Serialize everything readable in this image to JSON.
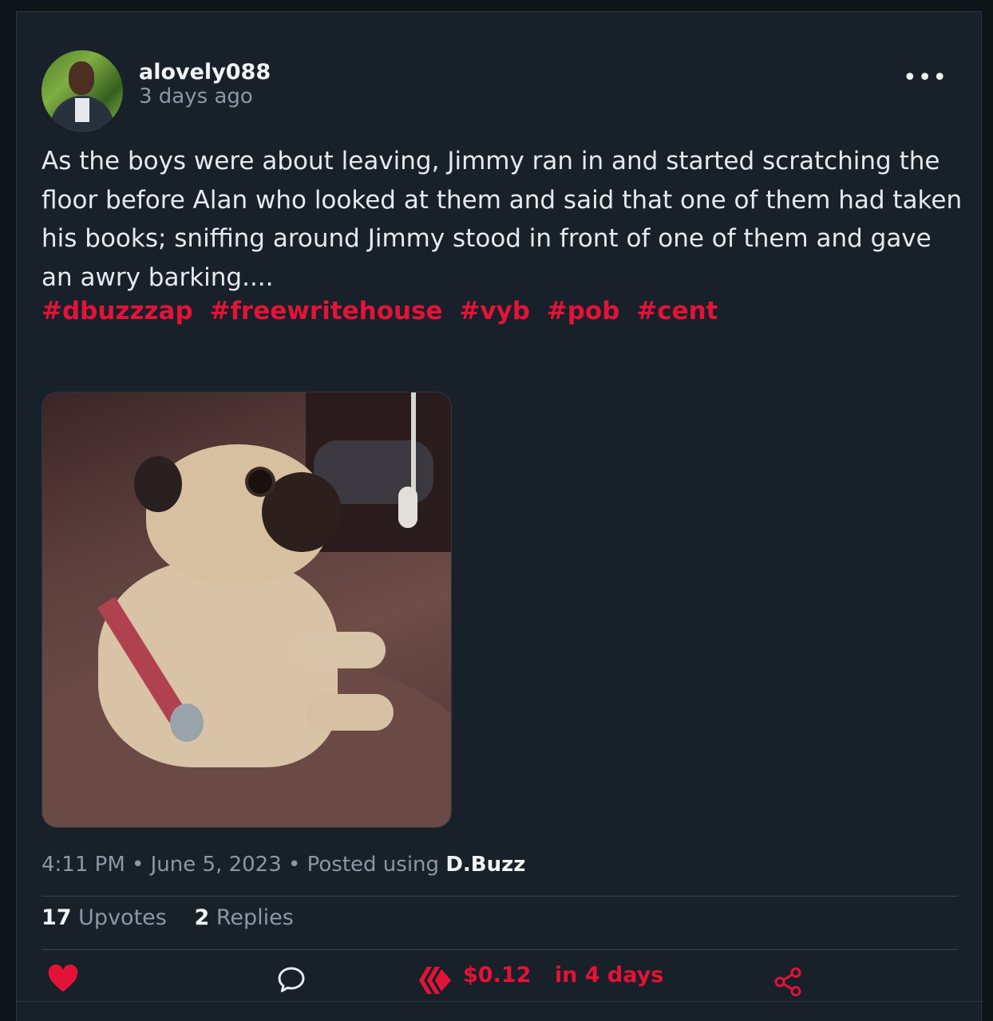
{
  "post": {
    "username": "alovely088",
    "time_ago": "3 days ago",
    "menu_icon": "more-dots-icon",
    "body": "As the boys were about leaving, Jimmy ran in and started scratching the floor before Alan who looked at them and said that one of them had taken his books; sniffing around Jimmy stood in front of one of them and gave an awry barking....",
    "hashtags": [
      "#dbuzzzap",
      "#freewritehouse",
      "#vyb",
      "#pob",
      "#cent"
    ],
    "meta": {
      "time": "4:11 PM",
      "date": "June 5, 2023",
      "posted_using": "Posted using",
      "app": "D.Buzz",
      "separator": "•"
    },
    "stats": {
      "upvotes_count": "17",
      "upvotes_label": "Upvotes",
      "replies_count": "2",
      "replies_label": "Replies"
    },
    "actions": {
      "like_icon": "heart-icon",
      "reply_icon": "comment-icon",
      "hive_icon": "hive-logo-icon",
      "payout": "$0.12",
      "payout_time": "in 4 days",
      "share_icon": "share-icon"
    }
  },
  "colors": {
    "background": "#0f1419",
    "card": "#18202a",
    "accent": "#e31337",
    "text": "#e6eaee",
    "muted": "#8b98a5"
  }
}
